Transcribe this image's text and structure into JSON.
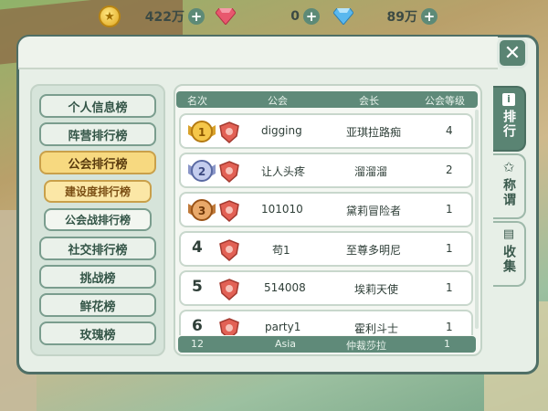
{
  "resources": {
    "gold": "422万",
    "red_gem": "0",
    "blue_gem": "89万"
  },
  "left_nav": [
    {
      "label": "个人信息榜",
      "active": false,
      "sub": false
    },
    {
      "label": "阵营排行榜",
      "active": false,
      "sub": false
    },
    {
      "label": "公会排行榜",
      "active": true,
      "sub": false
    },
    {
      "label": "建设度排行榜",
      "active": true,
      "sub": true
    },
    {
      "label": "公会战排行榜",
      "active": false,
      "sub": true
    },
    {
      "label": "社交排行榜",
      "active": false,
      "sub": false
    },
    {
      "label": "挑战榜",
      "active": false,
      "sub": false
    },
    {
      "label": "鲜花榜",
      "active": false,
      "sub": false
    },
    {
      "label": "玫瑰榜",
      "active": false,
      "sub": false
    }
  ],
  "table": {
    "headers": [
      "名次",
      "公会",
      "会长",
      "公会等级"
    ],
    "rows": [
      {
        "rank": "1",
        "guild": "digging",
        "leader": "亚琪拉路痴",
        "level": "4",
        "medal": "gold"
      },
      {
        "rank": "2",
        "guild": "让人头疼",
        "leader": "溜溜溜",
        "level": "2",
        "medal": "silver"
      },
      {
        "rank": "3",
        "guild": "101010",
        "leader": "黛莉冒险者",
        "level": "1",
        "medal": "bronze"
      },
      {
        "rank": "4",
        "guild": "苟1",
        "leader": "至尊多明尼",
        "level": "1",
        "medal": ""
      },
      {
        "rank": "5",
        "guild": "514008",
        "leader": "埃莉天使",
        "level": "1",
        "medal": ""
      },
      {
        "rank": "6",
        "guild": "party1",
        "leader": "霍利斗士",
        "level": "1",
        "medal": ""
      }
    ],
    "footer": {
      "rank": "12",
      "guild": "Asia",
      "leader": "仲裁莎拉",
      "level": "1"
    }
  },
  "right_tabs": [
    {
      "label": "排行",
      "icon": "info-icon",
      "active": true
    },
    {
      "label": "称谓",
      "icon": "star-icon",
      "active": false
    },
    {
      "label": "收集",
      "icon": "book-icon",
      "active": false
    }
  ],
  "colors": {
    "accent": "#5a8473",
    "active_nav": "#f7d980",
    "panel": "#e7efe7"
  }
}
